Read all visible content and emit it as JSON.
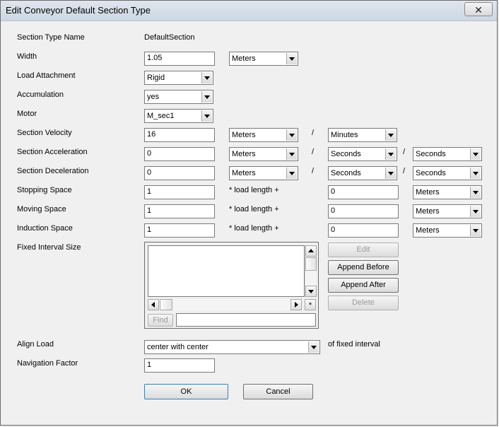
{
  "window": {
    "title": "Edit Conveyor Default Section Type",
    "close_glyph": "✕"
  },
  "form": {
    "section_type_name": {
      "label": "Section Type Name",
      "value": "DefaultSection"
    },
    "width": {
      "label": "Width",
      "value": "1.05",
      "unit": "Meters"
    },
    "load_attachment": {
      "label": "Load Attachment",
      "value": "Rigid"
    },
    "accumulation": {
      "label": "Accumulation",
      "value": "yes"
    },
    "motor": {
      "label": "Motor",
      "value": "M_sec1"
    },
    "section_velocity": {
      "label": "Section Velocity",
      "value": "16",
      "unit": "Meters",
      "sep": "/",
      "per": "Minutes"
    },
    "section_acceleration": {
      "label": "Section Acceleration",
      "value": "0",
      "unit": "Meters",
      "sep1": "/",
      "per1": "Seconds",
      "sep2": "/",
      "per2": "Seconds"
    },
    "section_deceleration": {
      "label": "Section Deceleration",
      "value": "0",
      "unit": "Meters",
      "sep1": "/",
      "per1": "Seconds",
      "sep2": "/",
      "per2": "Seconds"
    },
    "stopping_space": {
      "label": "Stopping Space",
      "factor": "1",
      "mult_label": "* load length +",
      "offset": "0",
      "unit": "Meters"
    },
    "moving_space": {
      "label": "Moving Space",
      "factor": "1",
      "mult_label": "* load length +",
      "offset": "0",
      "unit": "Meters"
    },
    "induction_space": {
      "label": "Induction Space",
      "factor": "1",
      "mult_label": "* load length +",
      "offset": "0",
      "unit": "Meters"
    },
    "fixed_interval_size": {
      "label": "Fixed Interval Size",
      "list_corner": "*",
      "find_label": "Find",
      "find_value": "",
      "buttons": {
        "edit": "Edit",
        "append_before": "Append Before",
        "append_after": "Append After",
        "delete": "Delete"
      }
    },
    "align_load": {
      "label": "Align Load",
      "value": "center with center",
      "suffix": "of fixed interval"
    },
    "navigation_factor": {
      "label": "Navigation Factor",
      "value": "1"
    }
  },
  "actions": {
    "ok": "OK",
    "cancel": "Cancel"
  }
}
